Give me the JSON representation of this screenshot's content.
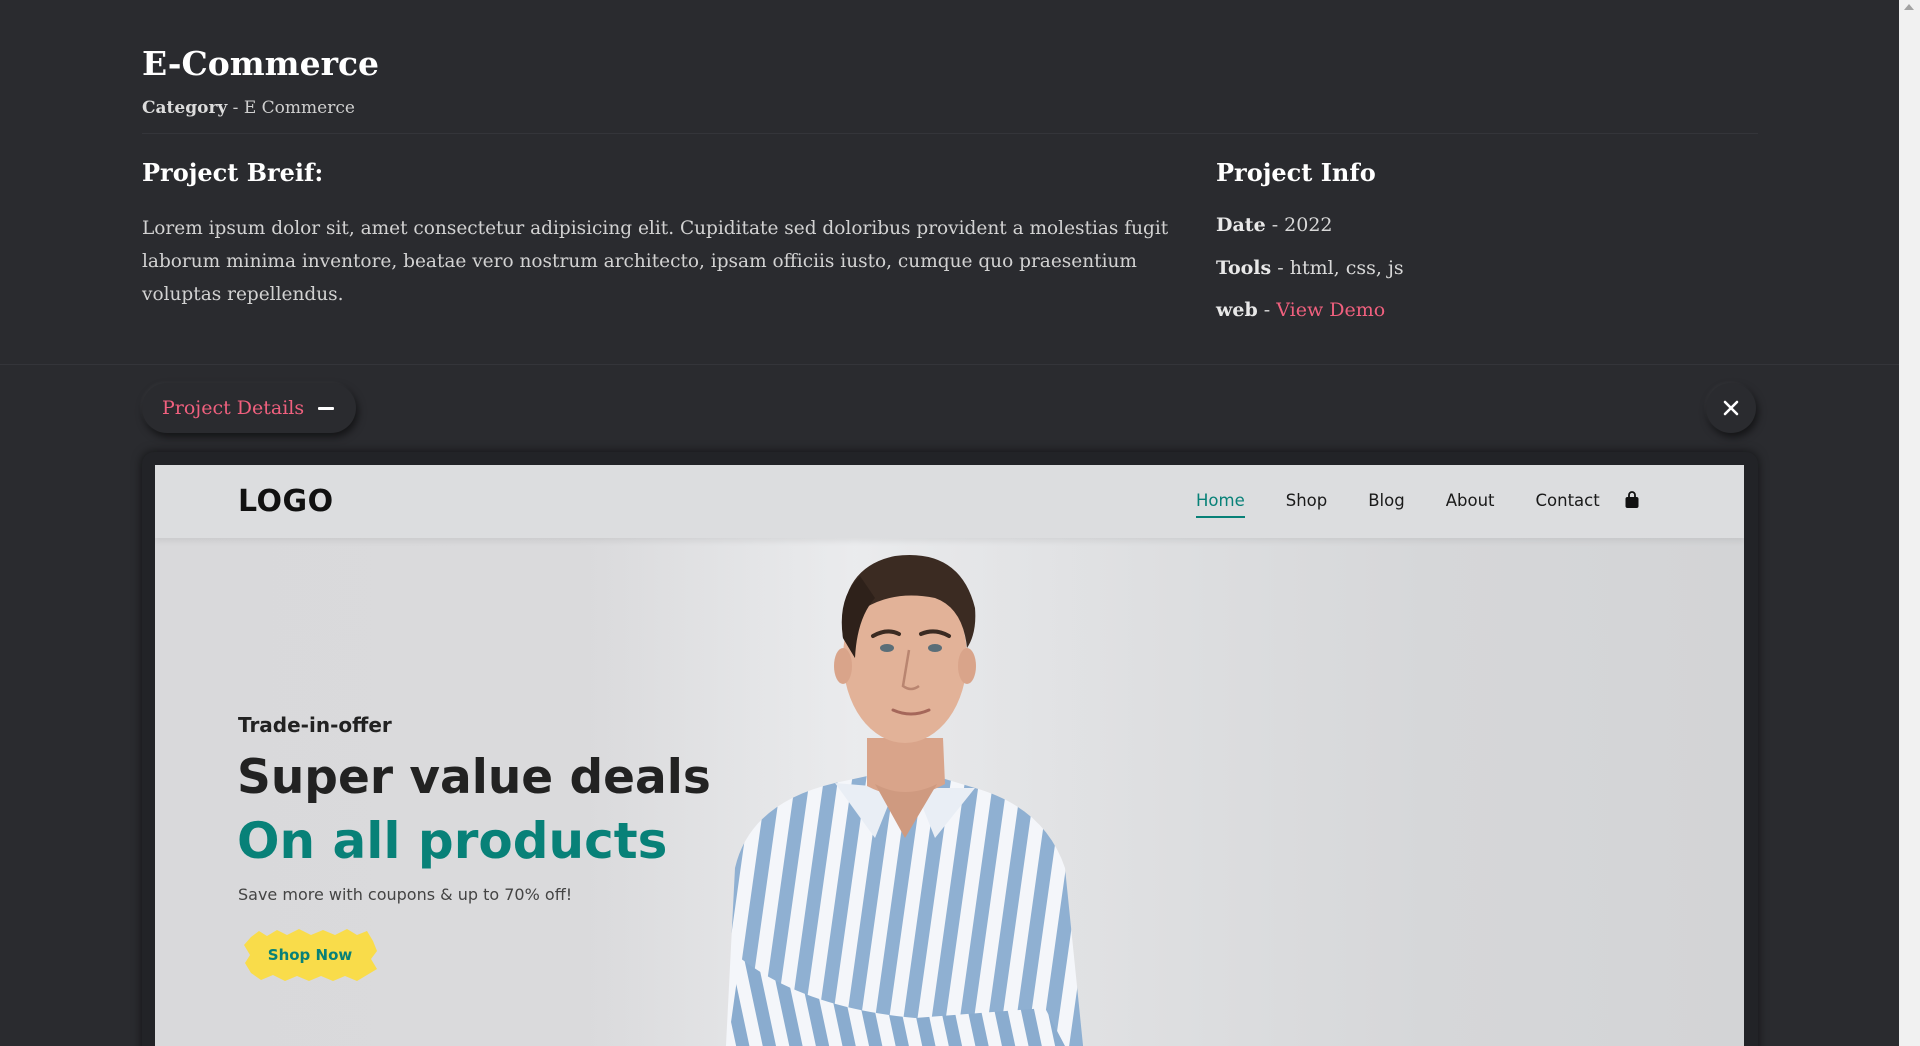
{
  "project": {
    "title": "E-Commerce",
    "category_label": "Category",
    "category_sep": " - ",
    "category_value": "E Commerce"
  },
  "brief": {
    "heading": "Project Breif:",
    "text": "Lorem ipsum dolor sit, amet consectetur adipisicing elit. Cupiditate sed doloribus provident a molestias fugit laborum minima inventore, beatae vero nostrum architecto, ipsam officiis iusto, cumque quo praesentium voluptas repellendus."
  },
  "info": {
    "heading": "Project Info",
    "date_label": "Date",
    "date_value": "2022",
    "tools_label": "Tools",
    "tools_value": "html, css, js",
    "web_label": "web",
    "web_link": "View Demo",
    "sep": " - "
  },
  "controls": {
    "details_label": "Project Details",
    "close_icon": "close-icon",
    "minus_icon": "minus-icon"
  },
  "preview": {
    "logo": "LOGO",
    "nav": [
      "Home",
      "Shop",
      "Blog",
      "About",
      "Contact"
    ],
    "active_nav": "Home",
    "cart_icon": "shopping-bag-icon",
    "hero_sub": "Trade-in-offer",
    "hero_title": "Super value deals",
    "hero_title2": "On all products",
    "hero_desc": "Save more with coupons & up to 70% off!",
    "cta": "Shop Now"
  },
  "colors": {
    "background": "#2a2b2f",
    "accent": "#f0607e",
    "brand_green": "#088178",
    "cta_yellow": "#f9dc4a"
  }
}
